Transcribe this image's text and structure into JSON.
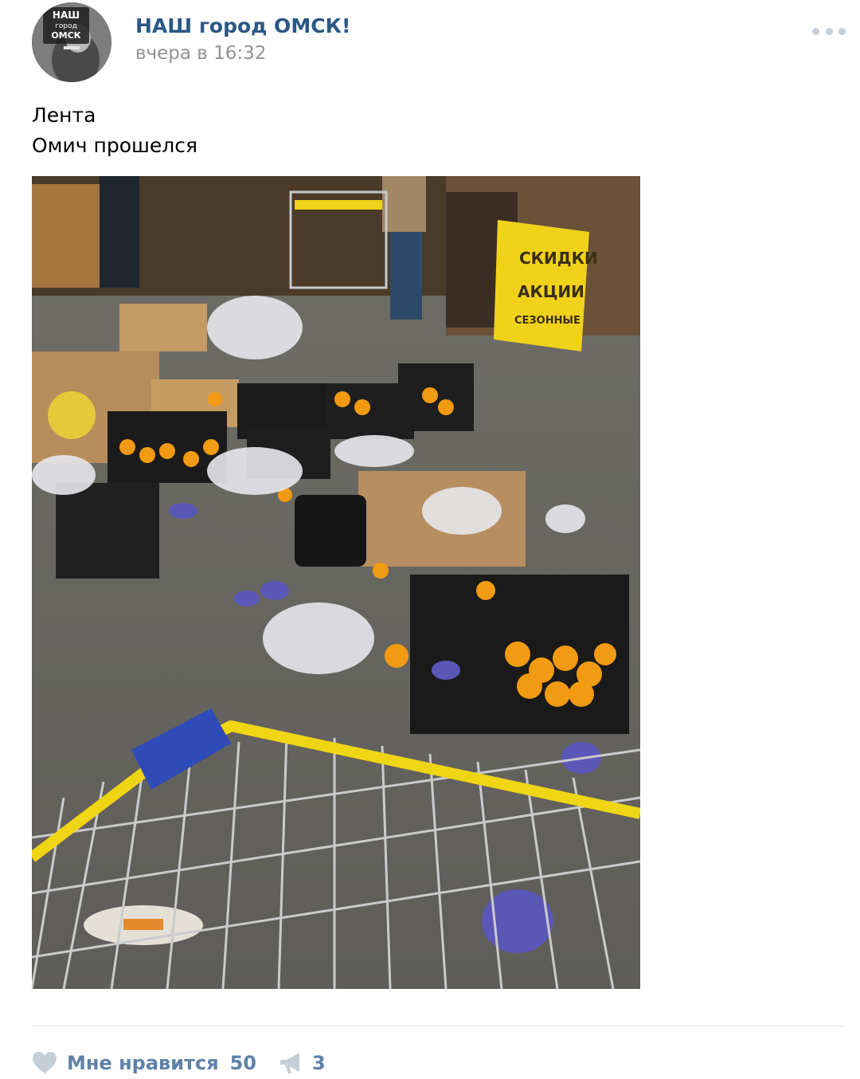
{
  "post": {
    "group_name": "НАШ город ОМСК!",
    "time": "вчера в 16:32",
    "text_lines": [
      "Лента",
      "Омич прошелся"
    ],
    "avatar_text": [
      "НАШ",
      "город",
      "ОМСК"
    ],
    "photo_signs": [
      "СКИДКИ",
      "АКЦИИ",
      "СЕЗОННЫЕ"
    ]
  },
  "footer": {
    "like_label": "Мне нравится",
    "like_count": "50",
    "share_count": "3"
  },
  "colors": {
    "link": "#2a5885",
    "muted": "#939393",
    "action": "#5e81a8",
    "icon": "#c5cdd6"
  },
  "icons": {
    "more": "more-dots-icon",
    "like": "heart-icon",
    "share": "megaphone-icon"
  }
}
